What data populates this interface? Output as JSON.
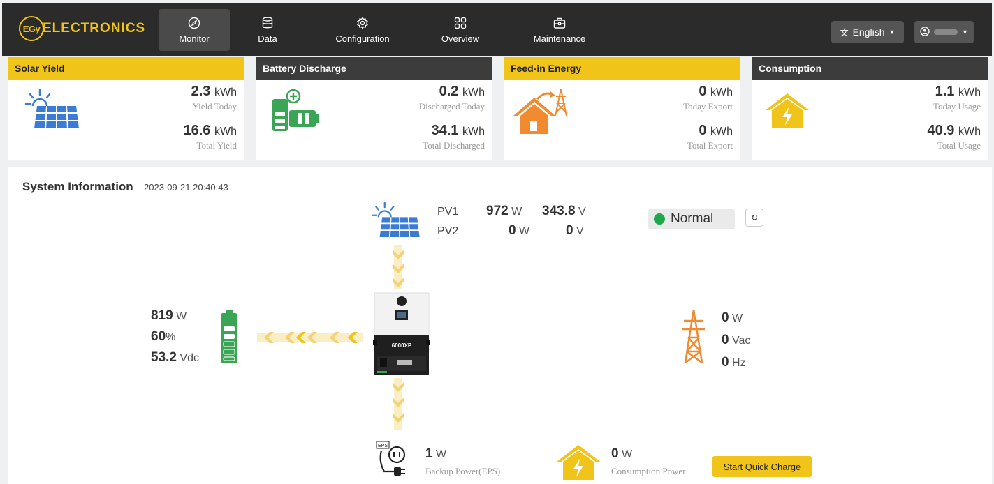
{
  "brand": {
    "badge": "EGy",
    "name": "ELECTRONICS"
  },
  "nav": [
    {
      "label": "Monitor",
      "icon": "compass-icon",
      "active": true
    },
    {
      "label": "Data",
      "icon": "database-icon",
      "active": false
    },
    {
      "label": "Configuration",
      "icon": "gear-icon",
      "active": false
    },
    {
      "label": "Overview",
      "icon": "grid-icon",
      "active": false
    },
    {
      "label": "Maintenance",
      "icon": "toolbox-icon",
      "active": false
    }
  ],
  "language": {
    "label": "English"
  },
  "cards": {
    "solar": {
      "title": "Solar Yield",
      "today_value": "2.3",
      "today_unit": "kWh",
      "today_label": "Yield Today",
      "total_value": "16.6",
      "total_unit": "kWh",
      "total_label": "Total Yield"
    },
    "battery": {
      "title": "Battery Discharge",
      "today_value": "0.2",
      "today_unit": "kWh",
      "today_label": "Discharged Today",
      "total_value": "34.1",
      "total_unit": "kWh",
      "total_label": "Total Discharged"
    },
    "feedin": {
      "title": "Feed-in Energy",
      "today_value": "0",
      "today_unit": "kWh",
      "today_label": "Today Export",
      "total_value": "0",
      "total_unit": "kWh",
      "total_label": "Total Export"
    },
    "consumption": {
      "title": "Consumption",
      "today_value": "1.1",
      "today_unit": "kWh",
      "today_label": "Today Usage",
      "total_value": "40.9",
      "total_unit": "kWh",
      "total_label": "Total Usage"
    }
  },
  "system": {
    "title": "System Information",
    "timestamp": "2023-09-21 20:40:43",
    "pv1": {
      "label": "PV1",
      "power": "972",
      "power_unit": "W",
      "voltage": "343.8",
      "voltage_unit": "V"
    },
    "pv2": {
      "label": "PV2",
      "power": "0",
      "power_unit": "W",
      "voltage": "0",
      "voltage_unit": "V"
    },
    "status": "Normal",
    "battery": {
      "power": "819",
      "power_unit": "W",
      "soc": "60",
      "soc_unit": "%",
      "voltage": "53.2",
      "voltage_unit": "Vdc"
    },
    "grid": {
      "power": "0",
      "power_unit": "W",
      "voltage": "0",
      "voltage_unit": "Vac",
      "freq": "0",
      "freq_unit": "Hz"
    },
    "inverter_model": "6000XP",
    "eps": {
      "value": "1",
      "unit": "W",
      "label": "Backup Power(EPS)",
      "tag": "EPS"
    },
    "consumption": {
      "value": "0",
      "unit": "W",
      "label": "Consumption Power"
    },
    "quick_charge_label": "Start Quick Charge"
  },
  "colors": {
    "accent": "#f0c419",
    "nav_bg": "#2b2b2b",
    "battery": "#3aa655",
    "grid": "#f28a30",
    "status_ok": "#1fa84a"
  }
}
